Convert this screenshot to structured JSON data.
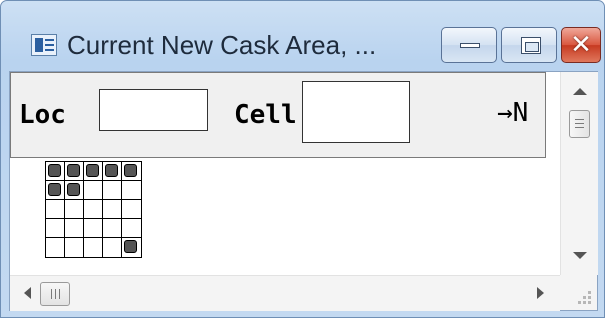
{
  "window": {
    "title": "Current New Cask Area, ...",
    "min_glyph": "—",
    "close_glyph": "✕"
  },
  "header": {
    "loc_label": "Loc",
    "loc_value": "",
    "cell_label": "Cell",
    "cell_value": "",
    "direction_label": "→N"
  },
  "cask_grid": {
    "rows": 5,
    "cols": 5,
    "occupied": [
      [
        0,
        0
      ],
      [
        0,
        1
      ],
      [
        0,
        2
      ],
      [
        0,
        3
      ],
      [
        0,
        4
      ],
      [
        1,
        0
      ],
      [
        1,
        1
      ],
      [
        4,
        4
      ]
    ]
  },
  "icons": {
    "app": "app-window-icon",
    "minimize": "minimize-icon",
    "maximize": "maximize-icon",
    "close": "close-icon",
    "scroll_up": "scroll-up-arrow-icon",
    "scroll_down": "scroll-down-arrow-icon",
    "scroll_left": "scroll-left-arrow-icon",
    "scroll_right": "scroll-right-arrow-icon",
    "resize": "resize-grip-icon"
  },
  "colors": {
    "close_button": "#c63a21",
    "title_bar": "#b9d3ef",
    "header_bg": "#f0f0f0",
    "cask_fill": "#555555"
  }
}
